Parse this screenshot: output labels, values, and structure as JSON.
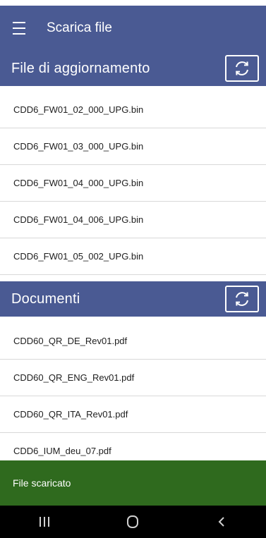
{
  "app_bar": {
    "title": "Scarica file",
    "menu_icon": "hamburger-icon"
  },
  "sections": [
    {
      "title": "File di aggiornamento",
      "refresh_icon": "refresh-icon",
      "items": [
        "CDD6_FW01_02_000_UPG.bin",
        "CDD6_FW01_03_000_UPG.bin",
        "CDD6_FW01_04_000_UPG.bin",
        "CDD6_FW01_04_006_UPG.bin",
        "CDD6_FW01_05_002_UPG.bin"
      ]
    },
    {
      "title": "Documenti",
      "refresh_icon": "refresh-icon",
      "items": [
        "CDD60_QR_DE_Rev01.pdf",
        "CDD60_QR_ENG_Rev01.pdf",
        "CDD60_QR_ITA_Rev01.pdf",
        "CDD6_IUM_deu_07.pdf"
      ]
    }
  ],
  "snackbar": {
    "message": "File scaricato"
  },
  "nav_bar": {
    "icons": [
      "recent-apps-icon",
      "home-icon",
      "back-icon"
    ]
  },
  "colors": {
    "primary": "#4a5a93",
    "snackbar": "#2f6a1e",
    "nav_bar": "#000000"
  }
}
